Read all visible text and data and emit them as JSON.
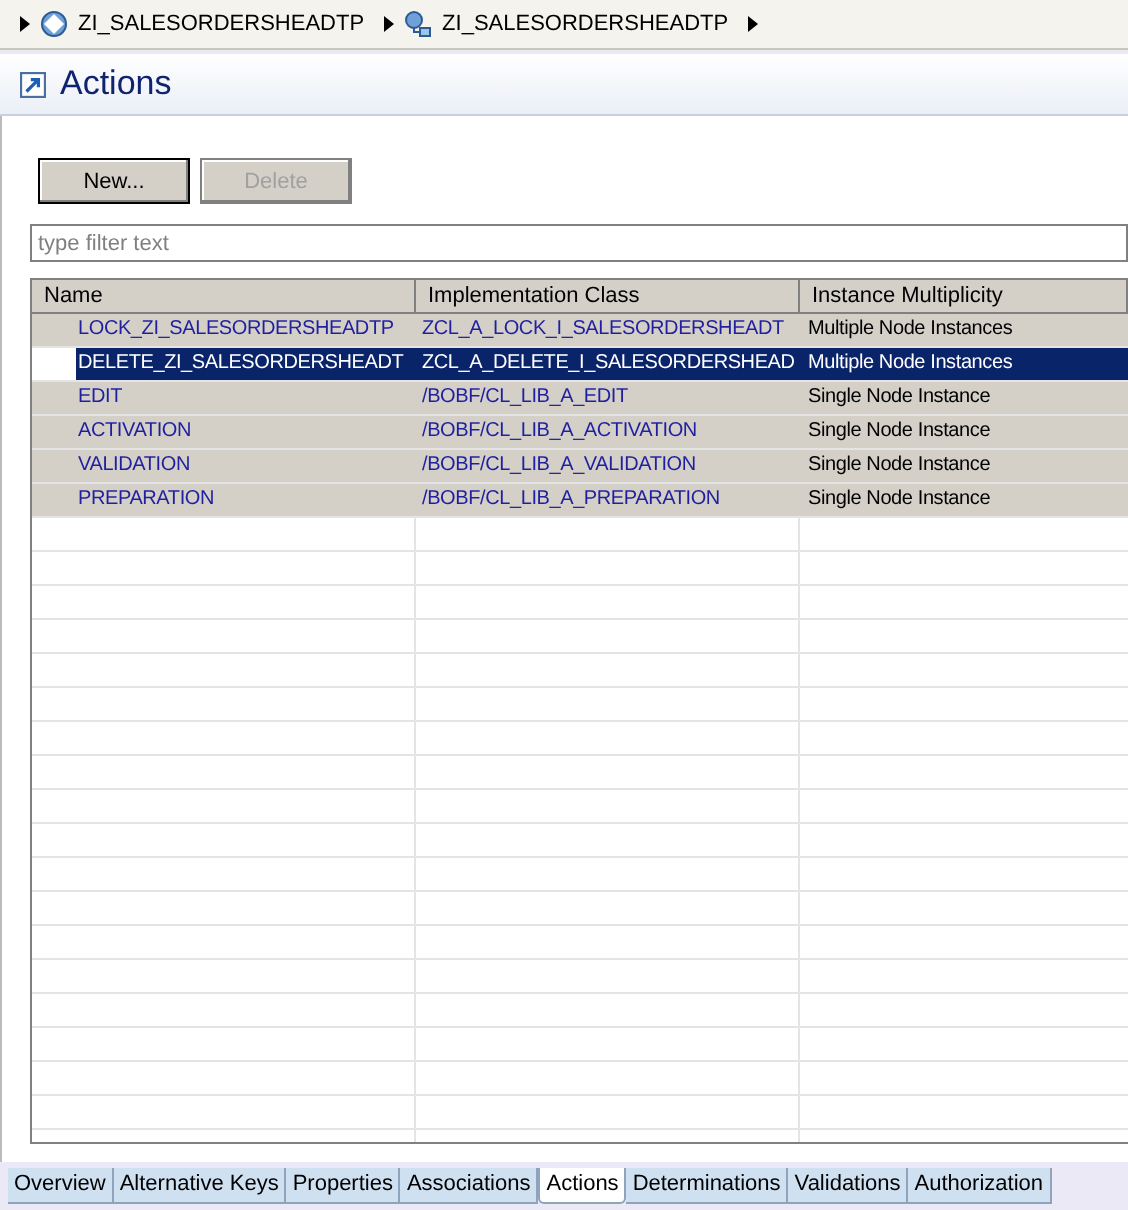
{
  "breadcrumb": [
    {
      "label": "ZI_SALESORDERSHEADTP",
      "kind": "node"
    },
    {
      "label": "ZI_SALESORDERSHEADTP",
      "kind": "object"
    }
  ],
  "title": "Actions",
  "buttons": [
    {
      "label": "New...",
      "disabled": false
    },
    {
      "label": "Delete",
      "disabled": true
    }
  ],
  "filter": {
    "placeholder": "type filter text"
  },
  "table": {
    "columns": [
      "Name",
      "Implementation Class",
      "Instance Multiplicity"
    ],
    "rows": [
      {
        "name": "LOCK_ZI_SALESORDERSHEADTP",
        "implementation_class": "ZCL_A_LOCK_I_SALESORDERSHEADT",
        "instance_multiplicity": "Multiple Node Instances",
        "selected": false
      },
      {
        "name": "DELETE_ZI_SALESORDERSHEADT",
        "implementation_class": "ZCL_A_DELETE_I_SALESORDERSHEAD",
        "instance_multiplicity": "Multiple Node Instances",
        "selected": true
      },
      {
        "name": "EDIT",
        "implementation_class": "/BOBF/CL_LIB_A_EDIT",
        "instance_multiplicity": "Single Node Instance",
        "selected": false
      },
      {
        "name": "ACTIVATION",
        "implementation_class": "/BOBF/CL_LIB_A_ACTIVATION",
        "instance_multiplicity": "Single Node Instance",
        "selected": false
      },
      {
        "name": "VALIDATION",
        "implementation_class": "/BOBF/CL_LIB_A_VALIDATION",
        "instance_multiplicity": "Single Node Instance",
        "selected": false
      },
      {
        "name": "PREPARATION",
        "implementation_class": "/BOBF/CL_LIB_A_PREPARATION",
        "instance_multiplicity": "Single Node Instance",
        "selected": false
      }
    ]
  },
  "tabs": [
    {
      "label": "Overview",
      "selected": false
    },
    {
      "label": "Alternative Keys",
      "selected": false
    },
    {
      "label": "Properties",
      "selected": false
    },
    {
      "label": "Associations",
      "selected": false
    },
    {
      "label": "Actions",
      "selected": true
    },
    {
      "label": "Determinations",
      "selected": false
    },
    {
      "label": "Validations",
      "selected": false
    },
    {
      "label": "Authorization",
      "selected": false
    }
  ]
}
